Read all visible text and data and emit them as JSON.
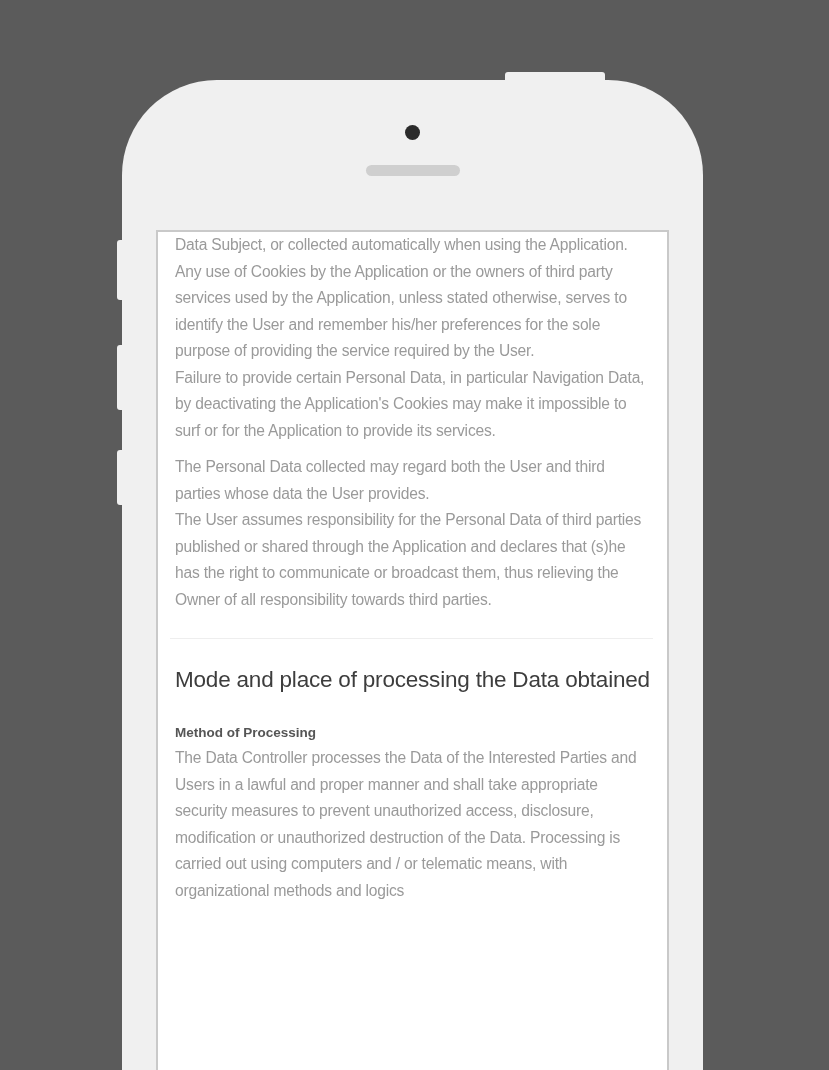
{
  "screen": {
    "intro_blocks": [
      [
        "Data Subject, or collected automatically when using the Application.",
        "Any use of Cookies by the Application or the owners of third party services used by the Application, unless stated otherwise, serves to identify the User and remember his/her preferences for the sole purpose of providing the service required by the User.",
        "Failure to provide certain Personal Data, in particular Navigation Data, by deactivating the Application's Cookies may make it impossible to surf or for the Application to provide its services."
      ],
      [
        "The Personal Data collected may regard both the User and third parties whose data the User provides.",
        "The User assumes responsibility for the Personal Data of third parties published or shared through the Application and declares that (s)he has the right to communicate or broadcast them, thus relieving the Owner of all responsibility towards third parties."
      ]
    ],
    "section": {
      "heading": "Mode and place of processing the Data obtained",
      "subheading": "Method of Processing",
      "text": "The Data Controller processes the Data of the Interested Parties and Users in a lawful and proper manner and shall take appropriate security measures to prevent unauthorized access, disclosure, modification or unauthorized destruction of the Data. Processing is carried out using computers and / or telematic means, with organizational methods and logics"
    }
  }
}
